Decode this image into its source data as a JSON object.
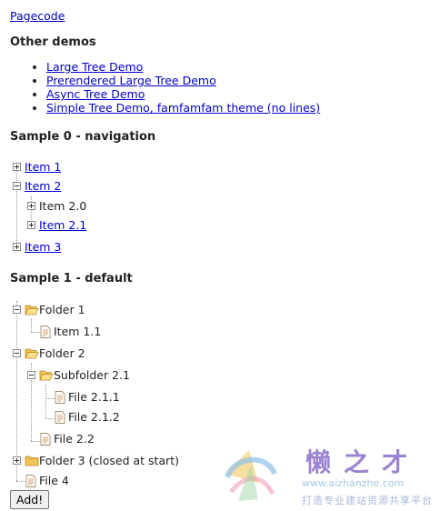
{
  "pagecode_link": "Pagecode",
  "other_demos": {
    "heading": "Other demos",
    "links": [
      "Large Tree Demo",
      "Prerendered Large Tree Demo",
      "Async Tree Demo",
      "Simple Tree Demo, famfamfam theme (no lines)"
    ]
  },
  "sample0": {
    "heading": "Sample 0 - navigation",
    "items": {
      "item1": "Item 1",
      "item2": "Item 2",
      "item20": "Item 2.0",
      "item21": "Item 2.1",
      "item3": "Item 3"
    }
  },
  "sample1": {
    "heading": "Sample 1 - default",
    "items": {
      "folder1": "Folder 1",
      "item11": "Item 1.1",
      "folder2": "Folder 2",
      "subfolder21": "Subfolder 2.1",
      "file211": "File 2.1.1",
      "file212": "File 2.1.2",
      "file22": "File 2.2",
      "folder3": "Folder 3 (closed at start)",
      "file4": "File 4"
    }
  },
  "add_button": "Add!",
  "watermark": {
    "chars": "懒之才",
    "url": "www.aizhanzhe.com",
    "sub": "打造专业建站资源共享平台"
  },
  "colors": {
    "link": "#0000cc",
    "folder": "#f2c45a",
    "watermark": "#8a6fc7"
  }
}
